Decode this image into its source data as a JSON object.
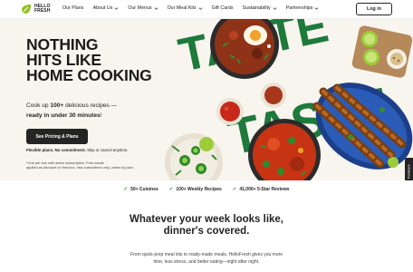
{
  "brand": {
    "logo_line1": "HELLO",
    "logo_line2": "FRESH",
    "color_green": "#91c11e",
    "color_dark": "#242424"
  },
  "nav": {
    "items": [
      {
        "label": "Our Plans",
        "has_dropdown": false
      },
      {
        "label": "About Us",
        "has_dropdown": true
      },
      {
        "label": "Our Menus",
        "has_dropdown": true
      },
      {
        "label": "Our Meal Kits",
        "has_dropdown": true
      },
      {
        "label": "Gift Cards",
        "has_dropdown": false
      },
      {
        "label": "Sustainability",
        "has_dropdown": true
      },
      {
        "label": "Partnerships",
        "has_dropdown": true
      }
    ],
    "login_label": "Log in"
  },
  "hero": {
    "headline": [
      "NOTHING",
      "HITS LIKE",
      "HOME COOKING"
    ],
    "sub_prefix": "Cook up ",
    "sub_bold1": "100+",
    "sub_mid": " delicious recipes —",
    "sub_bold2": "ready in under 30 minutes",
    "sub_suffix": "!",
    "cta_label": "See Pricing & Plans",
    "flex_bold": "Flexible plans. No commitment.",
    "flex_rest": " Skip or cancel anytime.",
    "fine_line1": "*One per box with active subscription. Free meals",
    "fine_line2": "applied as discount on first box, new subscribers only, varies by plan.",
    "feedback_label": "Feedback",
    "background_word": "TASTE"
  },
  "stats": [
    {
      "label": "50+ Cuisines"
    },
    {
      "label": "100+ Weekly Recipes"
    },
    {
      "label": "41,000+ 5-Star Reviews"
    }
  ],
  "lower": {
    "title_line1": "Whatever your week looks like,",
    "title_line2": "dinner's covered.",
    "body_line1": "From quick-prep meal kits to ready-made meals, HelloFresh gives you more",
    "body_line2": "time, less stress, and better eating—night after night."
  }
}
